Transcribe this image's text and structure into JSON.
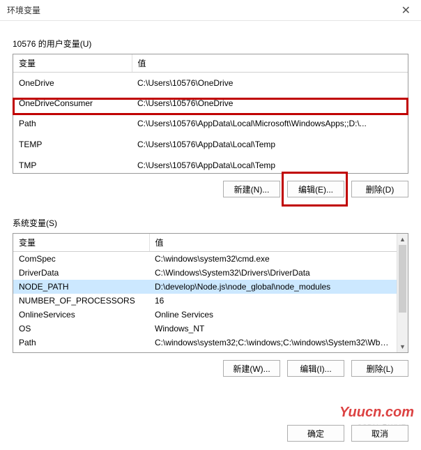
{
  "window": {
    "title": "环境变量"
  },
  "user": {
    "label": "10576 的用户变量(U)",
    "headers": {
      "var": "变量",
      "val": "值"
    },
    "rows": [
      {
        "var": "OneDrive",
        "val": "C:\\Users\\10576\\OneDrive"
      },
      {
        "var": "OneDriveConsumer",
        "val": "C:\\Users\\10576\\OneDrive"
      },
      {
        "var": "Path",
        "val": "C:\\Users\\10576\\AppData\\Local\\Microsoft\\WindowsApps;;D:\\..."
      },
      {
        "var": "TEMP",
        "val": "C:\\Users\\10576\\AppData\\Local\\Temp"
      },
      {
        "var": "TMP",
        "val": "C:\\Users\\10576\\AppData\\Local\\Temp"
      }
    ],
    "buttons": {
      "new": "新建(N)...",
      "edit": "编辑(E)...",
      "del": "删除(D)"
    }
  },
  "system": {
    "label": "系统变量(S)",
    "headers": {
      "var": "变量",
      "val": "值"
    },
    "rows": [
      {
        "var": "ComSpec",
        "val": "C:\\windows\\system32\\cmd.exe"
      },
      {
        "var": "DriverData",
        "val": "C:\\Windows\\System32\\Drivers\\DriverData"
      },
      {
        "var": "NODE_PATH",
        "val": "D:\\develop\\Node.js\\node_global\\node_modules"
      },
      {
        "var": "NUMBER_OF_PROCESSORS",
        "val": "16"
      },
      {
        "var": "OnlineServices",
        "val": "Online Services"
      },
      {
        "var": "OS",
        "val": "Windows_NT"
      },
      {
        "var": "Path",
        "val": "C:\\windows\\system32;C:\\windows;C:\\windows\\System32\\Wbe..."
      }
    ],
    "buttons": {
      "new": "新建(W)...",
      "edit": "编辑(I)...",
      "del": "删除(L)"
    }
  },
  "footer": {
    "ok": "确定",
    "cancel": "取消"
  },
  "watermark": "Yuucn.com",
  "csdn": "CSDN @WHF"
}
